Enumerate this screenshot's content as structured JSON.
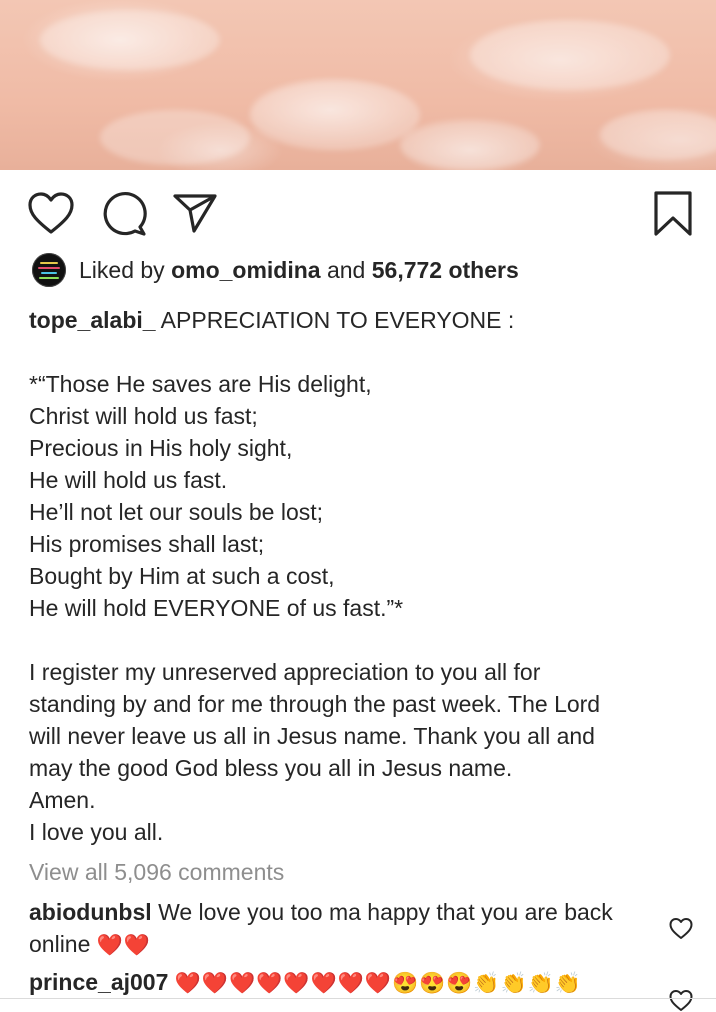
{
  "post": {
    "image_alt": "pink feathers photo",
    "liked_by": {
      "prefix": "Liked by",
      "user": "omo_omidina",
      "connector": "and",
      "others": "56,772 others"
    },
    "caption": {
      "username": "tope_alabi_",
      "headline": "APPRECIATION TO EVERYONE :",
      "verse_lines": [
        "*“Those He saves are His delight,",
        "Christ will hold us fast;",
        "Precious in His holy sight,",
        "He will hold us fast.",
        "He’ll not let our souls be lost;",
        "His promises shall last;",
        "Bought by Him at such a cost,",
        "He will hold EVERYONE of us fast.”*"
      ],
      "body_lines": [
        "I register my unreserved appreciation to you all for",
        "standing by and for me through the past week. The Lord",
        "will never leave us all in Jesus name. Thank you all and",
        "may the good God bless you all in Jesus name.",
        "Amen.",
        "I love you all."
      ]
    },
    "view_all_comments": "View all 5,096 comments",
    "comments": [
      {
        "username": "abiodunbsl",
        "text_line1": "We love you too ma happy that you are back",
        "text_line2": "online",
        "emoji": "❤️❤️"
      },
      {
        "username": "prince_aj007",
        "text_line1": "",
        "emoji": "❤️❤️❤️❤️❤️❤️❤️❤️😍😍😍👏👏👏👏"
      }
    ]
  },
  "icons": {
    "like": "heart-outline-icon",
    "comment": "comment-bubble-icon",
    "share": "paper-plane-icon",
    "save": "bookmark-icon"
  },
  "colors": {
    "text": "#262626",
    "muted": "#8e8e8e",
    "heart": "#e0202c"
  }
}
